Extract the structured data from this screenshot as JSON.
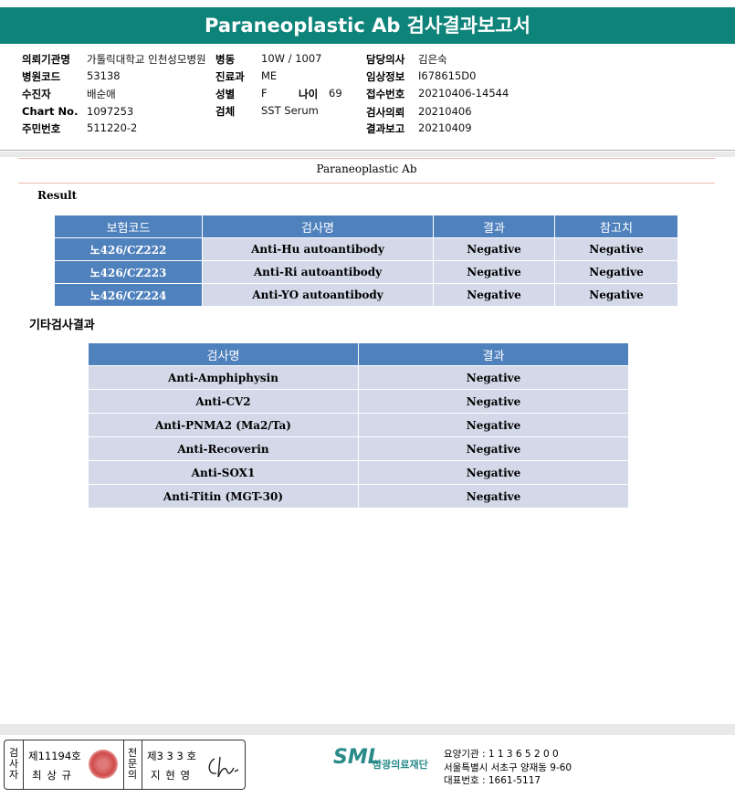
{
  "report_title": "Paraneoplastic Ab 검사결과보고서",
  "header": {
    "institution_label": "의뢰기관명",
    "institution": "가톨릭대학교 인천성모병원",
    "ward_label": "병동",
    "ward": "10W / 1007",
    "doctor_label": "담당의사",
    "doctor": "김은숙",
    "hospital_code_label": "병원코드",
    "hospital_code": "53138",
    "dept_label": "진료과",
    "dept": "ME",
    "clinical_label": "임상정보",
    "clinical": "I678615D0",
    "patient_label": "수진자",
    "patient": "배순애",
    "sex_label": "성별",
    "sex": "F",
    "age_label": "나이",
    "age": "69",
    "receipt_label": "접수번호",
    "receipt": "20210406-14544",
    "chart_label": "Chart No.",
    "chart": "1097253",
    "specimen_label": "검체",
    "specimen": "SST Serum",
    "request_date_label": "검사의뢰",
    "request_date": "20210406",
    "id_label": "주민번호",
    "id": "511220-2",
    "report_date_label": "결과보고",
    "report_date": "20210409"
  },
  "section_title": "Paraneoplastic Ab",
  "result_label": "Result",
  "result_table": {
    "headers": [
      "보험코드",
      "검사명",
      "결과",
      "참고치"
    ],
    "rows": [
      [
        "노426/CZ222",
        "Anti-Hu autoantibody",
        "Negative",
        "Negative"
      ],
      [
        "노426/CZ223",
        "Anti-Ri autoantibody",
        "Negative",
        "Negative"
      ],
      [
        "노426/CZ224",
        "Anti-YO autoantibody",
        "Negative",
        "Negative"
      ]
    ]
  },
  "other_label": "기타검사결과",
  "other_table": {
    "headers": [
      "검사명",
      "결과"
    ],
    "rows": [
      [
        "Anti-Amphiphysin",
        "Negative"
      ],
      [
        "Anti-CV2",
        "Negative"
      ],
      [
        "Anti-PNMA2 (Ma2/Ta)",
        "Negative"
      ],
      [
        "Anti-Recoverin",
        "Negative"
      ],
      [
        "Anti-SOX1",
        "Negative"
      ],
      [
        "Anti-Titin (MGT-30)",
        "Negative"
      ]
    ]
  },
  "footer": {
    "tester_label": "검사자",
    "tester_no": "제11194호",
    "tester_name": "최 상 규",
    "specialist_label": "전문의",
    "specialist_no": "제3 3 3 호",
    "specialist_name": "지 현 영",
    "logo": "SML",
    "logo_ko": "삼광의료재단",
    "org_code": "요양기관 : 1 1 3 6 5 2 0 0",
    "org_address": "서울특별시 서초구 양재동 9-60",
    "org_phone": "대표번호 : 1661-5117"
  },
  "colors": {
    "title_bar": "#0e8379",
    "table_header": "#4f81bd",
    "table_cell": "#d3d9e8",
    "logo": "#2a8a8a"
  }
}
